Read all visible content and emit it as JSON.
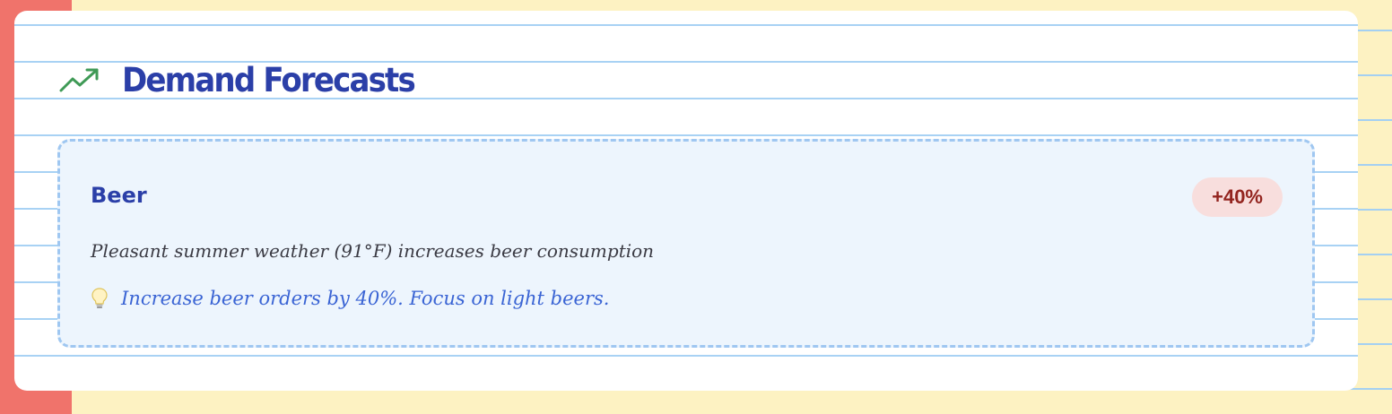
{
  "section": {
    "title": "Demand Forecasts",
    "icon": "trending-up-icon",
    "icon_color": "#3f9a56"
  },
  "forecasts": [
    {
      "item": "Beer",
      "change": "+40%",
      "reason": "Pleasant summer weather (91°F) increases beer consumption",
      "recommendation_icon": "lightbulb-icon",
      "recommendation": "Increase beer orders by 40%. Focus on light beers."
    }
  ],
  "colors": {
    "page_background": "#fdf2c2",
    "margin_strip": "#f0736b",
    "notebook_line": "#a8d2f4",
    "title": "#2b3fa8",
    "card_background": "#edf5fd",
    "card_border": "#9fc7f1",
    "badge_background": "#f8dedd",
    "badge_text": "#93241f",
    "recommendation_text": "#3a64d4"
  }
}
